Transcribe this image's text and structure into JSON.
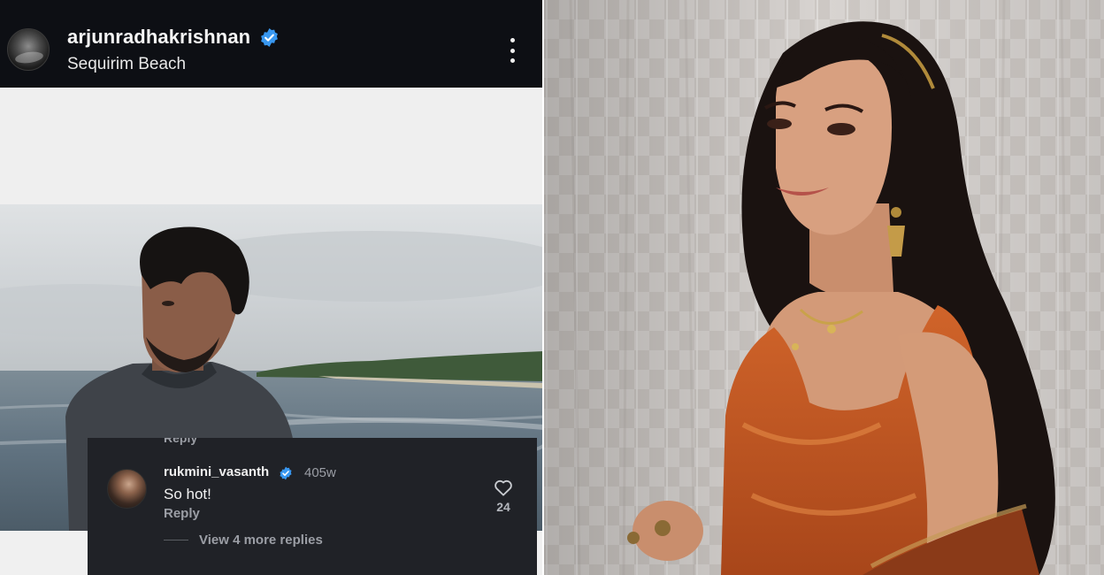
{
  "post": {
    "username": "arjunradhakrishnan",
    "location": "Sequirim Beach",
    "verified_icon": "verified-badge-icon",
    "more_icon": "more-vertical-icon"
  },
  "comment": {
    "prev_reply_label": "Reply",
    "username": "rukmini_vasanth",
    "time": "405w",
    "text": "So hot!",
    "reply_label": "Reply",
    "likes": "24",
    "view_more_label": "View 4 more replies",
    "heart_icon": "heart-icon"
  },
  "colors": {
    "header_bg": "#0d0f14",
    "comment_bg": "#202227",
    "verified_blue": "#3897f0",
    "saree_orange": "#c2541f"
  }
}
